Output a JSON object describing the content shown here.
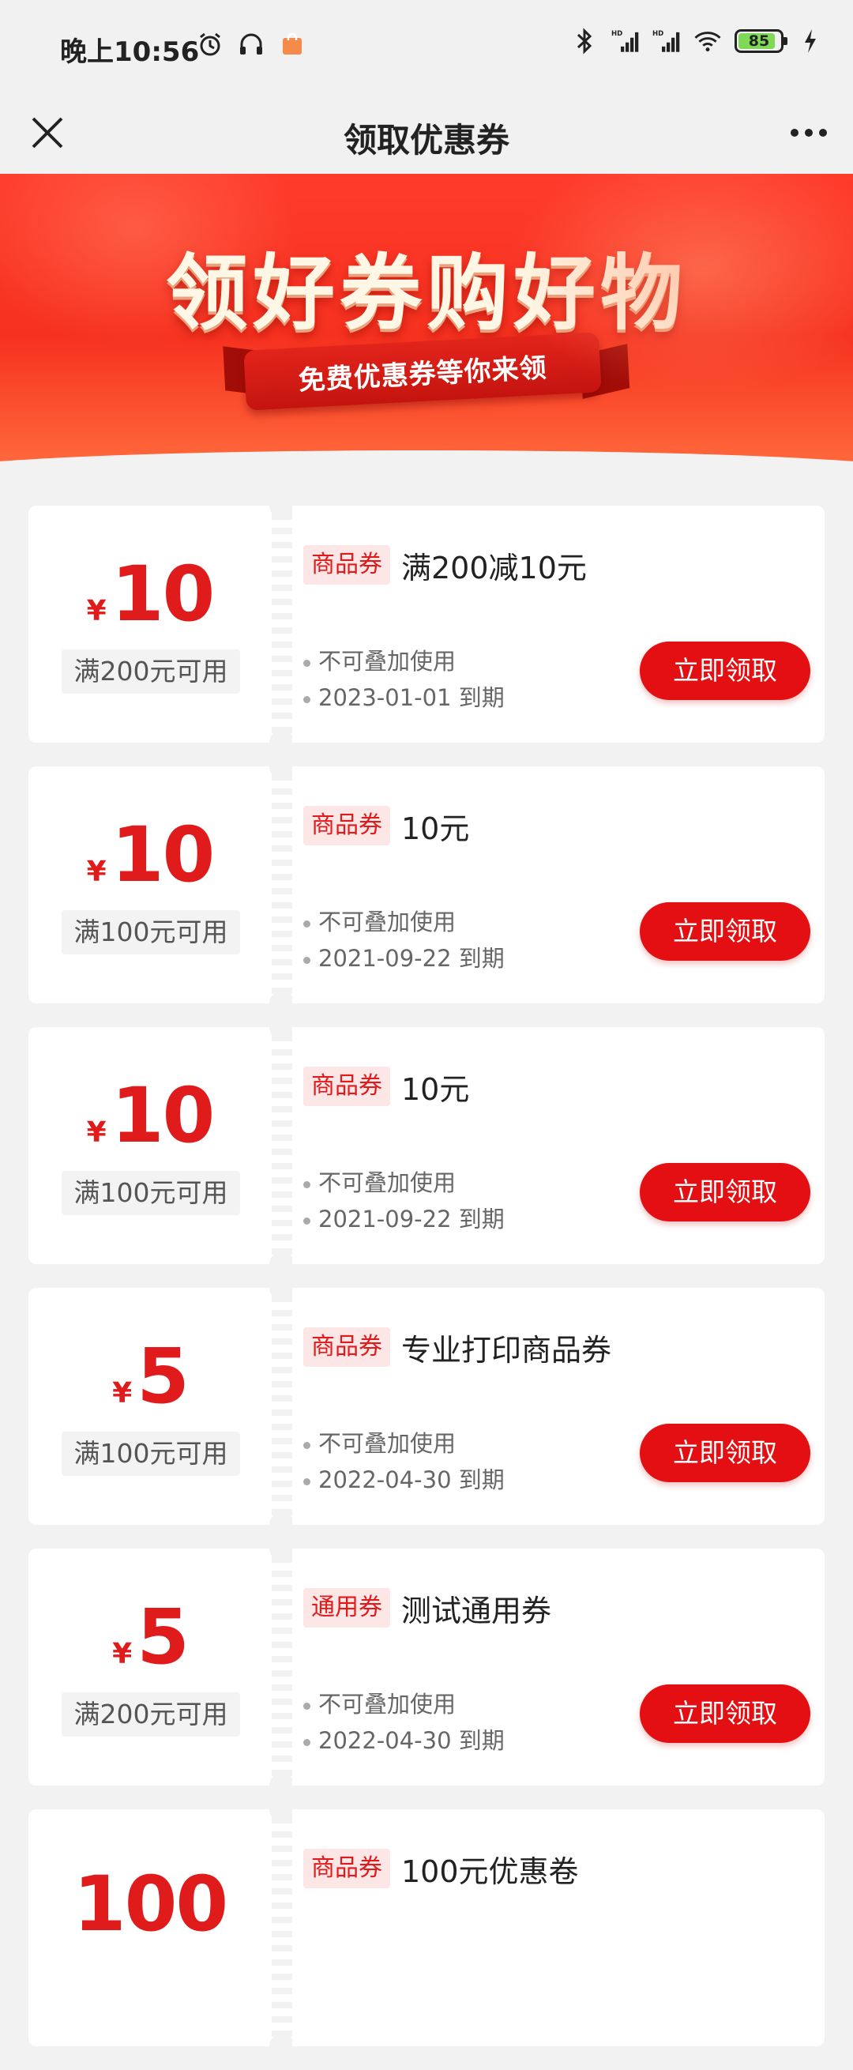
{
  "status_bar": {
    "time": "晚上10:56",
    "icons_left": [
      "alarm-icon",
      "headset-icon",
      "shopping-bag-icon"
    ],
    "icons_right": [
      "bluetooth-icon",
      "hd-signal-icon",
      "hd-signal-icon",
      "wifi-icon"
    ],
    "battery_level": "85"
  },
  "nav": {
    "title": "领取优惠券",
    "close_icon": "close-icon",
    "more_icon": "more-icon"
  },
  "banner": {
    "headline": "领好券购好物",
    "ribbon_text": "免费优惠券等你来领"
  },
  "coupons": [
    {
      "currency": "¥",
      "amount": "10",
      "condition": "满200元可用",
      "tag": "商品券",
      "title": "满200减10元",
      "rule": "不可叠加使用",
      "expiry": "2023-01-01 到期",
      "button": "立即领取"
    },
    {
      "currency": "¥",
      "amount": "10",
      "condition": "满100元可用",
      "tag": "商品券",
      "title": "10元",
      "rule": "不可叠加使用",
      "expiry": "2021-09-22 到期",
      "button": "立即领取"
    },
    {
      "currency": "¥",
      "amount": "10",
      "condition": "满100元可用",
      "tag": "商品券",
      "title": "10元",
      "rule": "不可叠加使用",
      "expiry": "2021-09-22 到期",
      "button": "立即领取"
    },
    {
      "currency": "¥",
      "amount": "5",
      "condition": "满100元可用",
      "tag": "商品券",
      "title": "专业打印商品券",
      "rule": "不可叠加使用",
      "expiry": "2022-04-30 到期",
      "button": "立即领取"
    },
    {
      "currency": "¥",
      "amount": "5",
      "condition": "满200元可用",
      "tag": "通用券",
      "title": "测试通用券",
      "rule": "不可叠加使用",
      "expiry": "2022-04-30 到期",
      "button": "立即领取"
    },
    {
      "currency": "",
      "amount": "100",
      "condition": "",
      "tag": "商品券",
      "title": "100元优惠卷",
      "rule": "",
      "expiry": "",
      "button": ""
    }
  ],
  "colors": {
    "accent_red": "#e30f12",
    "amount_red": "#e01b1b",
    "tag_bg": "#fde6e6",
    "page_bg": "#f2f2f2"
  }
}
